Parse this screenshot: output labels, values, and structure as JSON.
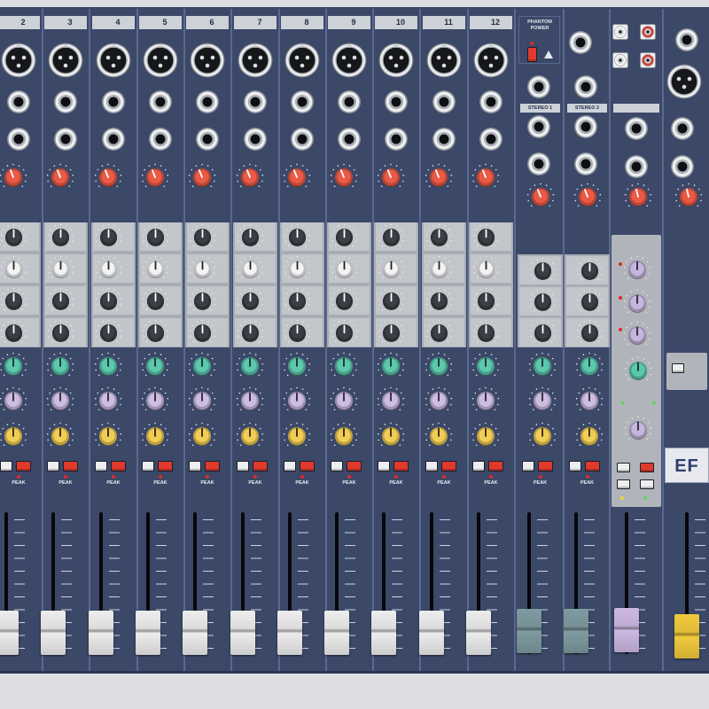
{
  "channels": [
    {
      "number": "2"
    },
    {
      "number": "3"
    },
    {
      "number": "4"
    },
    {
      "number": "5"
    },
    {
      "number": "6"
    },
    {
      "number": "7"
    },
    {
      "number": "8"
    },
    {
      "number": "9"
    },
    {
      "number": "10"
    },
    {
      "number": "11"
    },
    {
      "number": "12"
    }
  ],
  "strip_text": {
    "peak": "PEAK"
  },
  "phantom": {
    "label": "PHANTOM POWER"
  },
  "stereo_channels": [
    {
      "label": "STEREO 1"
    },
    {
      "label": "STEREO 2"
    }
  ],
  "brand": {
    "logo": "EF"
  },
  "icons": {
    "mic_input": "xlr-input-icon",
    "line_input": "jack-input-icon",
    "two_track": "rca-jack-icon",
    "phantom_warning": "warning-icon"
  },
  "colors": {
    "panel": "#3b4868",
    "divider": "#5b6990",
    "label_bar": "#cdd1d8",
    "eq_panel": "#a9adb4",
    "eq_row": "#c2c5ca",
    "master_panel": "#b1b5bb",
    "gain_knob": "#ea5a45",
    "eq_knob": "#3b3e45",
    "eq_freq_knob": "#f3f3f3",
    "aux_knob": "#5cc8ad",
    "fx_knob": "#cdbde2",
    "pan_knob": "#f2cd55",
    "master_knob": "#c6b6dd",
    "pfl_button": "#eeeeee",
    "mute_button": "#e03a2c",
    "peak_led": "#e02a20",
    "green_led": "#5fd35a",
    "yellow_led": "#f2d23a",
    "rca_white": "#f4f4f4",
    "rca_red": "#d3403a",
    "fader_cap": "#ededed",
    "stereo_fader_cap": "#7f9ba1",
    "master_fader_cap": "#cdb9e3",
    "main_fader_cap": "#f1c93c"
  },
  "knob_values": {
    "gain": 0.42,
    "eq_gain": 0.5,
    "eq_freq": 0.5,
    "aux": 0.5,
    "fx": 0.5,
    "pan": 0.5,
    "stereo_return": 0.45
  },
  "fader_levels": {
    "mono": 0.12,
    "stereo": 0.14,
    "master": 0.15,
    "main": 0.09
  }
}
